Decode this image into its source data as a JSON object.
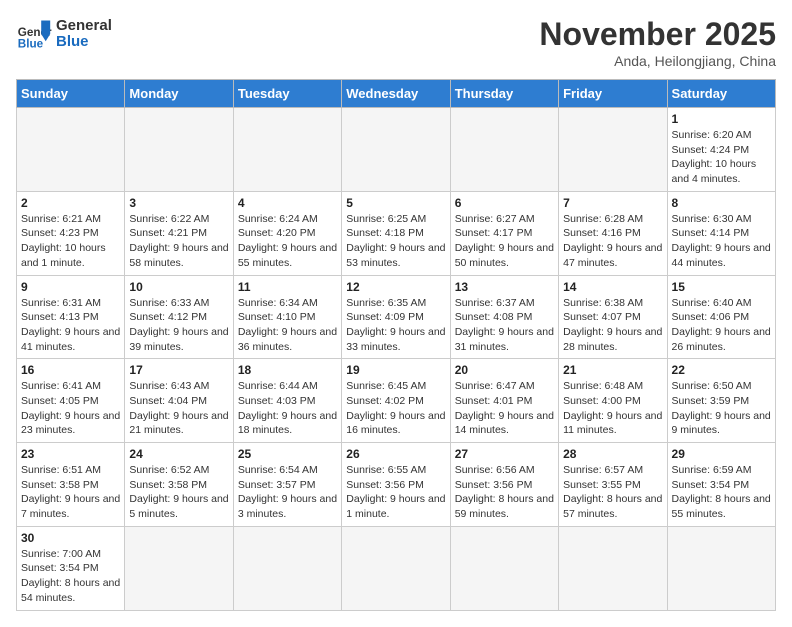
{
  "header": {
    "logo_general": "General",
    "logo_blue": "Blue",
    "month_year": "November 2025",
    "location": "Anda, Heilongjiang, China"
  },
  "weekdays": [
    "Sunday",
    "Monday",
    "Tuesday",
    "Wednesday",
    "Thursday",
    "Friday",
    "Saturday"
  ],
  "weeks": [
    [
      {
        "day": "",
        "info": ""
      },
      {
        "day": "",
        "info": ""
      },
      {
        "day": "",
        "info": ""
      },
      {
        "day": "",
        "info": ""
      },
      {
        "day": "",
        "info": ""
      },
      {
        "day": "",
        "info": ""
      },
      {
        "day": "1",
        "info": "Sunrise: 6:20 AM\nSunset: 4:24 PM\nDaylight: 10 hours and 4 minutes."
      }
    ],
    [
      {
        "day": "2",
        "info": "Sunrise: 6:21 AM\nSunset: 4:23 PM\nDaylight: 10 hours and 1 minute."
      },
      {
        "day": "3",
        "info": "Sunrise: 6:22 AM\nSunset: 4:21 PM\nDaylight: 9 hours and 58 minutes."
      },
      {
        "day": "4",
        "info": "Sunrise: 6:24 AM\nSunset: 4:20 PM\nDaylight: 9 hours and 55 minutes."
      },
      {
        "day": "5",
        "info": "Sunrise: 6:25 AM\nSunset: 4:18 PM\nDaylight: 9 hours and 53 minutes."
      },
      {
        "day": "6",
        "info": "Sunrise: 6:27 AM\nSunset: 4:17 PM\nDaylight: 9 hours and 50 minutes."
      },
      {
        "day": "7",
        "info": "Sunrise: 6:28 AM\nSunset: 4:16 PM\nDaylight: 9 hours and 47 minutes."
      },
      {
        "day": "8",
        "info": "Sunrise: 6:30 AM\nSunset: 4:14 PM\nDaylight: 9 hours and 44 minutes."
      }
    ],
    [
      {
        "day": "9",
        "info": "Sunrise: 6:31 AM\nSunset: 4:13 PM\nDaylight: 9 hours and 41 minutes."
      },
      {
        "day": "10",
        "info": "Sunrise: 6:33 AM\nSunset: 4:12 PM\nDaylight: 9 hours and 39 minutes."
      },
      {
        "day": "11",
        "info": "Sunrise: 6:34 AM\nSunset: 4:10 PM\nDaylight: 9 hours and 36 minutes."
      },
      {
        "day": "12",
        "info": "Sunrise: 6:35 AM\nSunset: 4:09 PM\nDaylight: 9 hours and 33 minutes."
      },
      {
        "day": "13",
        "info": "Sunrise: 6:37 AM\nSunset: 4:08 PM\nDaylight: 9 hours and 31 minutes."
      },
      {
        "day": "14",
        "info": "Sunrise: 6:38 AM\nSunset: 4:07 PM\nDaylight: 9 hours and 28 minutes."
      },
      {
        "day": "15",
        "info": "Sunrise: 6:40 AM\nSunset: 4:06 PM\nDaylight: 9 hours and 26 minutes."
      }
    ],
    [
      {
        "day": "16",
        "info": "Sunrise: 6:41 AM\nSunset: 4:05 PM\nDaylight: 9 hours and 23 minutes."
      },
      {
        "day": "17",
        "info": "Sunrise: 6:43 AM\nSunset: 4:04 PM\nDaylight: 9 hours and 21 minutes."
      },
      {
        "day": "18",
        "info": "Sunrise: 6:44 AM\nSunset: 4:03 PM\nDaylight: 9 hours and 18 minutes."
      },
      {
        "day": "19",
        "info": "Sunrise: 6:45 AM\nSunset: 4:02 PM\nDaylight: 9 hours and 16 minutes."
      },
      {
        "day": "20",
        "info": "Sunrise: 6:47 AM\nSunset: 4:01 PM\nDaylight: 9 hours and 14 minutes."
      },
      {
        "day": "21",
        "info": "Sunrise: 6:48 AM\nSunset: 4:00 PM\nDaylight: 9 hours and 11 minutes."
      },
      {
        "day": "22",
        "info": "Sunrise: 6:50 AM\nSunset: 3:59 PM\nDaylight: 9 hours and 9 minutes."
      }
    ],
    [
      {
        "day": "23",
        "info": "Sunrise: 6:51 AM\nSunset: 3:58 PM\nDaylight: 9 hours and 7 minutes."
      },
      {
        "day": "24",
        "info": "Sunrise: 6:52 AM\nSunset: 3:58 PM\nDaylight: 9 hours and 5 minutes."
      },
      {
        "day": "25",
        "info": "Sunrise: 6:54 AM\nSunset: 3:57 PM\nDaylight: 9 hours and 3 minutes."
      },
      {
        "day": "26",
        "info": "Sunrise: 6:55 AM\nSunset: 3:56 PM\nDaylight: 9 hours and 1 minute."
      },
      {
        "day": "27",
        "info": "Sunrise: 6:56 AM\nSunset: 3:56 PM\nDaylight: 8 hours and 59 minutes."
      },
      {
        "day": "28",
        "info": "Sunrise: 6:57 AM\nSunset: 3:55 PM\nDaylight: 8 hours and 57 minutes."
      },
      {
        "day": "29",
        "info": "Sunrise: 6:59 AM\nSunset: 3:54 PM\nDaylight: 8 hours and 55 minutes."
      }
    ],
    [
      {
        "day": "30",
        "info": "Sunrise: 7:00 AM\nSunset: 3:54 PM\nDaylight: 8 hours and 54 minutes."
      },
      {
        "day": "",
        "info": ""
      },
      {
        "day": "",
        "info": ""
      },
      {
        "day": "",
        "info": ""
      },
      {
        "day": "",
        "info": ""
      },
      {
        "day": "",
        "info": ""
      },
      {
        "day": "",
        "info": ""
      }
    ]
  ]
}
